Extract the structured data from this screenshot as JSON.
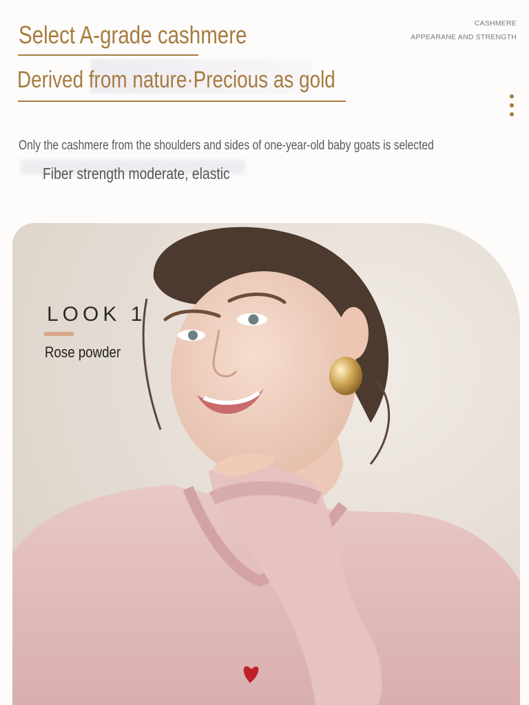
{
  "header": {
    "title": "Select A-grade cashmere",
    "subtitle": "Derived from nature·Precious as gold",
    "tag_line1": "CASHMERE",
    "tag_line2": "APPEARANE AND STRENGTH"
  },
  "description": {
    "line1": "Only the cashmere from the shoulders and sides of one-year-old baby goats is selected",
    "line2": "Fiber strength moderate, elastic"
  },
  "look": {
    "title": "LOOK 1",
    "color_name": "Rose powder"
  },
  "colors": {
    "accent_gold": "#a67b3e",
    "look_bar": "#d7a98a",
    "sweater_pink": "#e3bcbc",
    "background": "#fdfcfb"
  },
  "icons": {
    "menu": "more-vertical-icon"
  }
}
